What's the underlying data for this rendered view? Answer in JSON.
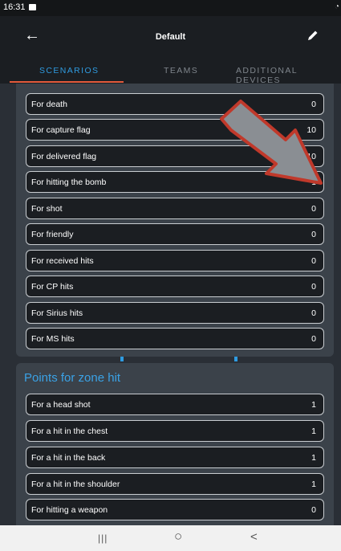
{
  "status": {
    "time": "16:31"
  },
  "header": {
    "title": "Default"
  },
  "tabs": [
    "SCENARIOS",
    "TEAMS",
    "ADDITIONAL DEVICES"
  ],
  "scenario_rows": [
    {
      "label": "For death",
      "value": "0"
    },
    {
      "label": "For capture flag",
      "value": "10"
    },
    {
      "label": "For delivered flag",
      "value": "10"
    },
    {
      "label": "For hitting the bomb",
      "value": "1"
    },
    {
      "label": "For shot",
      "value": "0"
    },
    {
      "label": "For friendly",
      "value": "0"
    },
    {
      "label": "For received hits",
      "value": "0"
    },
    {
      "label": "For CP hits",
      "value": "0"
    },
    {
      "label": "For Sirius hits",
      "value": "0"
    },
    {
      "label": "For MS hits",
      "value": "0"
    }
  ],
  "zone": {
    "title": "Points for zone hit",
    "rows": [
      {
        "label": "For a head shot",
        "value": "1"
      },
      {
        "label": "For a hit in the chest",
        "value": "1"
      },
      {
        "label": "For a hit in the back",
        "value": "1"
      },
      {
        "label": "For a hit in the shoulder",
        "value": "1"
      },
      {
        "label": "For hitting a weapon",
        "value": "0"
      }
    ]
  },
  "navbar": {
    "recents": "|||",
    "home": "○",
    "back": "<"
  },
  "colors": {
    "accent": "#2f9be0",
    "indicator": "#e35a3b",
    "arrow": "#c0392b"
  }
}
